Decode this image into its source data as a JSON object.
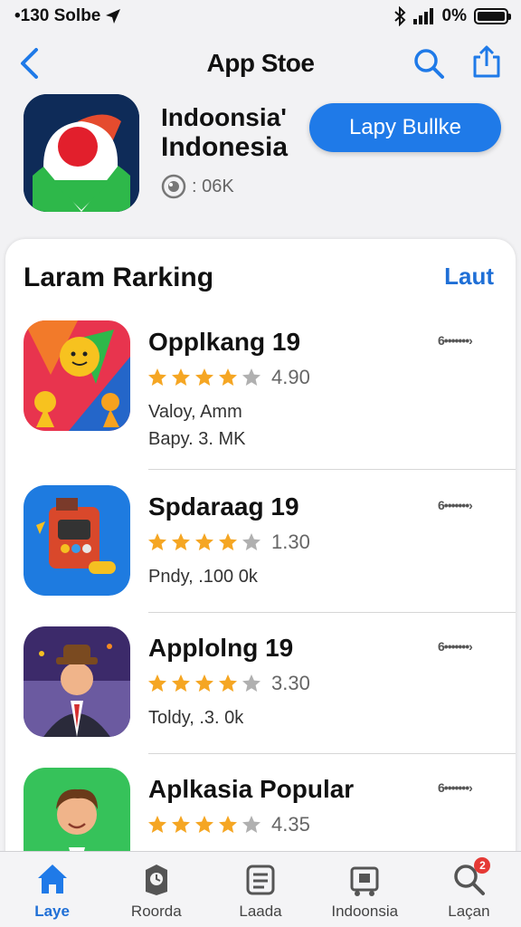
{
  "status_bar": {
    "time": "•130 Solbe",
    "battery_percent": "0%"
  },
  "nav": {
    "title": "App Stoe"
  },
  "header_app": {
    "name_line1": "Indoonsia'",
    "name_line2": "Indonesia",
    "meta": ": 06K",
    "button_label": "Lapy Bullke"
  },
  "ranking": {
    "title": "Laram Rarking",
    "link": "Laut",
    "items": [
      {
        "name": "Opplkang 19",
        "rating": "4.90",
        "stars": 4,
        "sub1": "Valoy, Amm",
        "sub2": "Bapy. 3. MK",
        "more": "6•••••••›"
      },
      {
        "name": "Spdaraag 19",
        "rating": "1.30",
        "stars": 4,
        "sub1": "Pndy, .100 0k",
        "sub2": "",
        "more": "6•••••••›"
      },
      {
        "name": "Applolng 19",
        "rating": "3.30",
        "stars": 4,
        "sub1": "Toldy, .3. 0k",
        "sub2": "",
        "more": "6•••••••›"
      },
      {
        "name": "Aplkasia Popular",
        "rating": "4.35",
        "stars": 4,
        "sub1": "",
        "sub2": "",
        "more": "6•••••••›"
      }
    ]
  },
  "tabs": [
    {
      "label": "Laye",
      "icon": "home-icon",
      "active": true
    },
    {
      "label": "Roorda",
      "icon": "clock-book-icon",
      "active": false
    },
    {
      "label": "Laada",
      "icon": "document-icon",
      "active": false
    },
    {
      "label": "Indoonsia",
      "icon": "cart-icon",
      "active": false
    },
    {
      "label": "Laçan",
      "icon": "search-icon",
      "active": false,
      "badge": "2"
    }
  ],
  "colors": {
    "accent": "#1f7ae8",
    "star": "#f5a623",
    "star_empty": "#b0b0b0"
  }
}
